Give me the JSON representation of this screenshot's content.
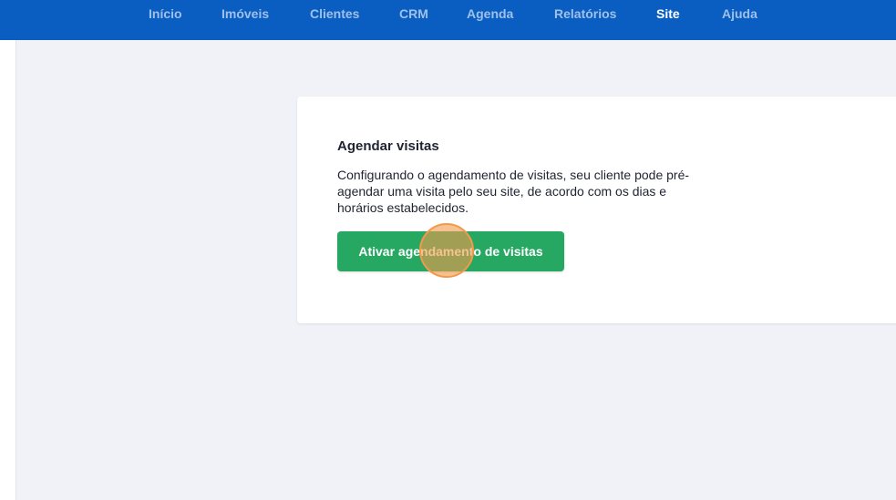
{
  "nav": {
    "items": [
      {
        "label": "Início"
      },
      {
        "label": "Imóveis"
      },
      {
        "label": "Clientes"
      },
      {
        "label": "CRM"
      },
      {
        "label": "Agenda"
      },
      {
        "label": "Relatórios"
      },
      {
        "label": "Site",
        "active": true
      },
      {
        "label": "Ajuda"
      }
    ]
  },
  "card": {
    "title": "Agendar visitas",
    "description": "Configurando o agendamento de visitas, seu cliente pode pré-agendar uma visita pelo seu site, de acordo com os dias e horários estabelecidos.",
    "button_label": "Ativar agendamento de visitas"
  },
  "colors": {
    "topbar": "#0a5ec2",
    "nav_inactive": "#9fc0ea",
    "nav_active": "#ffffff",
    "button": "#27a862",
    "background": "#f0f2f7",
    "click_indicator": "#f2994a"
  }
}
